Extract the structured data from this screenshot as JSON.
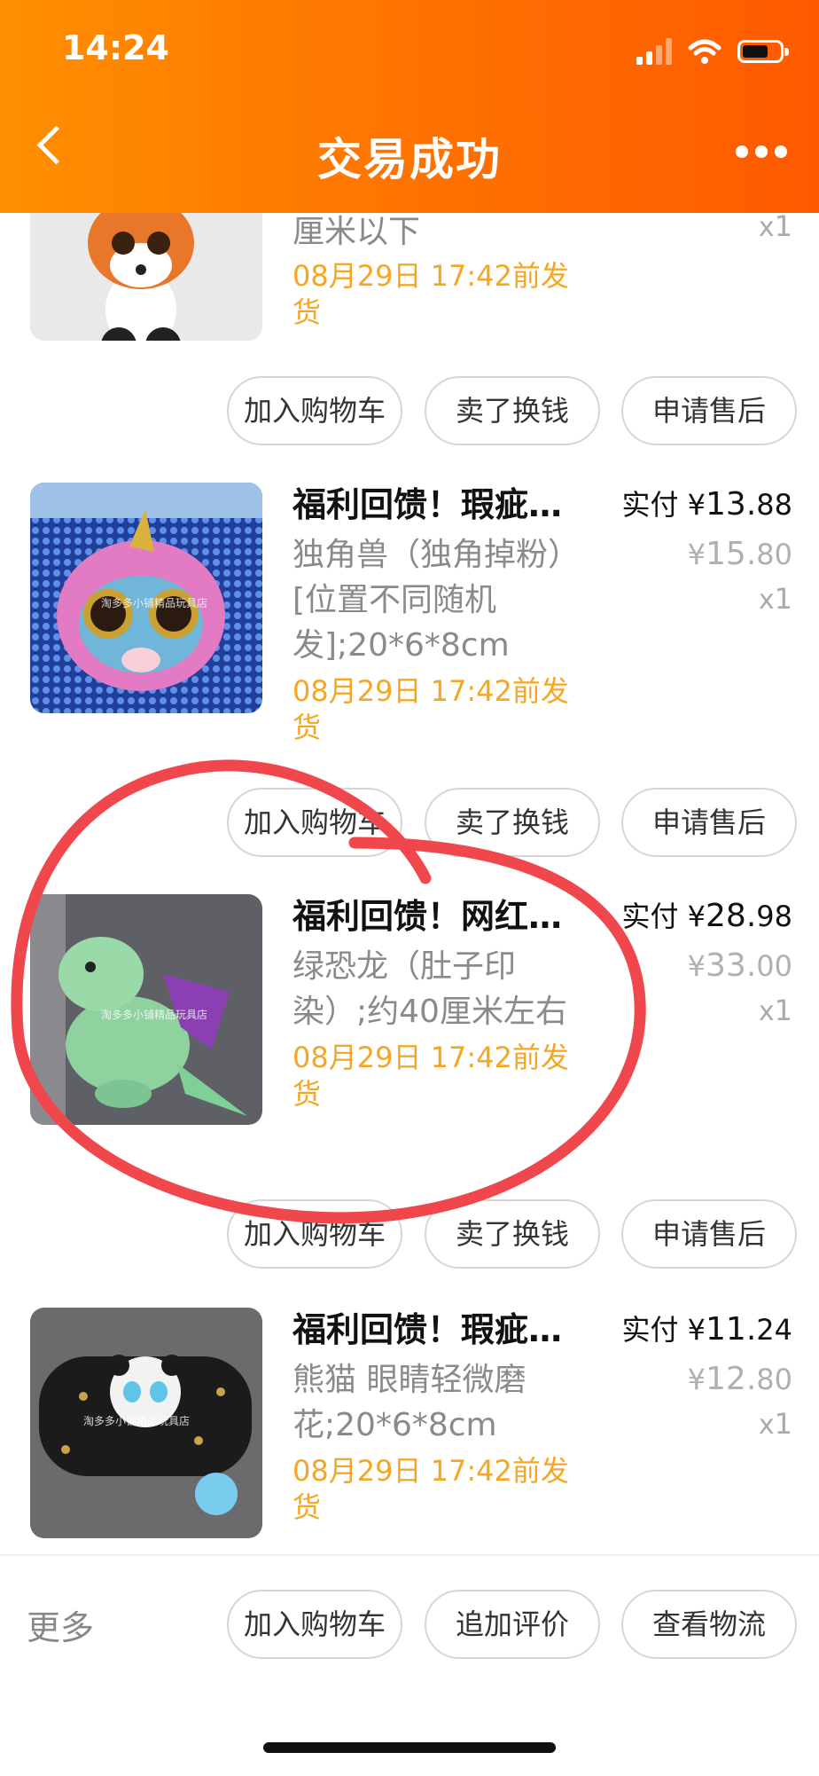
{
  "status_bar": {
    "time": "14:24"
  },
  "nav": {
    "title": "交易成功"
  },
  "items": [
    {
      "spec": "厘米以下",
      "ship": "08月29日 17:42前发货",
      "qty_x": "x",
      "qty_n": "1"
    },
    {
      "title": "福利回馈！瑕疵…",
      "spec": "独角兽（独角掉粉）[位置不同随机发];20*6*8cm",
      "ship": "08月29日 17:42前发货",
      "price_label": "实付",
      "currency": "¥",
      "price_int": "13.",
      "price_dec": "88",
      "orig_int": "15.",
      "orig_dec": "80",
      "qty_x": "x",
      "qty_n": "1"
    },
    {
      "title": "福利回馈！网红…",
      "spec": "绿恐龙（肚子印染）;约40厘米左右",
      "ship": "08月29日 17:42前发货",
      "price_label": "实付",
      "currency": "¥",
      "price_int": "28.",
      "price_dec": "98",
      "orig_int": "33.",
      "orig_dec": "00",
      "qty_x": "x",
      "qty_n": "1"
    },
    {
      "title": "福利回馈！瑕疵…",
      "spec": "熊猫 眼睛轻微磨花;20*6*8cm",
      "ship": "08月29日 17:42前发货",
      "price_label": "实付",
      "currency": "¥",
      "price_int": "11.",
      "price_dec": "24",
      "orig_int": "12.",
      "orig_dec": "80",
      "qty_x": "x",
      "qty_n": "1"
    }
  ],
  "item_actions": {
    "add_cart": "加入购物车",
    "resell": "卖了换钱",
    "after_sale": "申请售后"
  },
  "footer": {
    "more": "更多",
    "add_cart": "加入购物车",
    "add_review": "追加评价",
    "logistics": "查看物流"
  },
  "colors": {
    "header_start": "#ff8f00",
    "header_end": "#ff5a00",
    "ship_text": "#f5a623",
    "annotation": "#f0474d"
  },
  "thumbnail_watermark": "淘多多小铺精品玩具店"
}
